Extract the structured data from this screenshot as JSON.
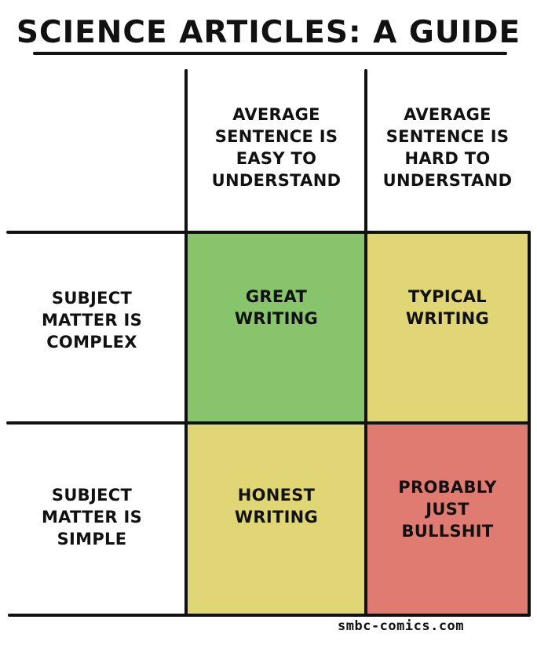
{
  "title": "SCIENCE ARTICLES: A GUIDE",
  "columns": [
    {
      "label": "AVERAGE\nSENTENCE IS\nEASY TO\nUNDERSTAND"
    },
    {
      "label": "AVERAGE\nSENTENCE IS\nHARD TO\nUNDERSTAND"
    }
  ],
  "rows": [
    {
      "label": "SUBJECT\nMATTER IS\nCOMPLEX"
    },
    {
      "label": "SUBJECT\nMATTER IS\nSIMPLE"
    }
  ],
  "cells": [
    {
      "text": "GREAT\nWRITING",
      "color": "#88c46b"
    },
    {
      "text": "TYPICAL\nWRITING",
      "color": "#e0d675"
    },
    {
      "text": "HONEST\nWRITING",
      "color": "#e0d675"
    },
    {
      "text": "PROBABLY\nJUST\nBULLSHIT",
      "color": "#e07b72"
    }
  ],
  "credit": "smbc-comics.com"
}
